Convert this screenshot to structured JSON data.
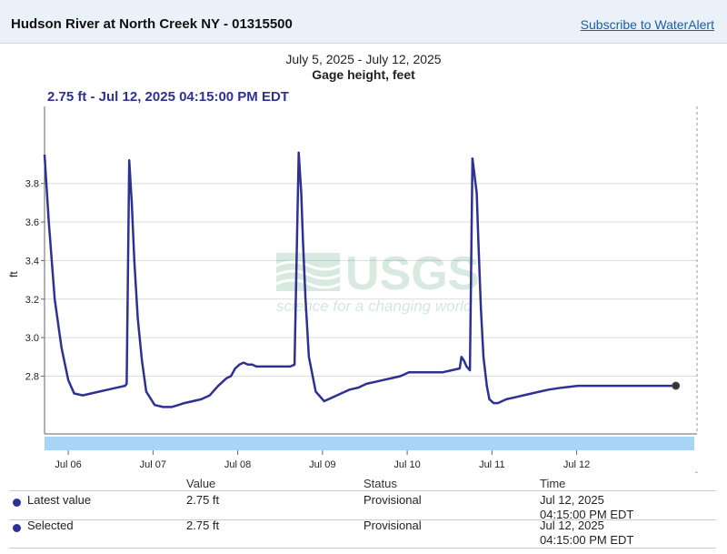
{
  "header": {
    "station_title": "Hudson River at North Creek NY - 01315500",
    "subscribe_label": "Subscribe to WaterAlert"
  },
  "chart_data": {
    "type": "line",
    "date_range": "July 5, 2025 - July 12, 2025",
    "title": "Gage height, feet",
    "selected_readout": "2.75 ft - Jul 12, 2025 04:15:00 PM EDT",
    "ylabel": "ft",
    "xlabel": "",
    "ylim": [
      2.5,
      4.2
    ],
    "xlim": [
      0,
      7.7
    ],
    "y_ticks": [
      2.8,
      3.0,
      3.2,
      3.4,
      3.6,
      3.8
    ],
    "x_tick_labels": [
      "Jul 06",
      "Jul 07",
      "Jul 08",
      "Jul 09",
      "Jul 10",
      "Jul 11",
      "Jul 12"
    ],
    "x_tick_positions": [
      0.28,
      1.28,
      2.28,
      3.28,
      4.28,
      5.28,
      6.28
    ],
    "grid": true,
    "line_color": "#2e3192",
    "series": [
      {
        "x": [
          0.0,
          0.05,
          0.12,
          0.2,
          0.28,
          0.35,
          0.45,
          0.55,
          0.65,
          0.75,
          0.85,
          0.95,
          0.97,
          1.0,
          1.03,
          1.06,
          1.1,
          1.15,
          1.2,
          1.3,
          1.4,
          1.5,
          1.58,
          1.65,
          1.75,
          1.85,
          1.95,
          2.05,
          2.15,
          2.2,
          2.25,
          2.3,
          2.35,
          2.4,
          2.45,
          2.5,
          2.55,
          2.6,
          2.7,
          2.8,
          2.9,
          2.95,
          3.0,
          3.03,
          3.05,
          3.08,
          3.12,
          3.2,
          3.3,
          3.4,
          3.5,
          3.6,
          3.7,
          3.8,
          3.9,
          4.0,
          4.1,
          4.2,
          4.3,
          4.4,
          4.5,
          4.6,
          4.7,
          4.8,
          4.9,
          4.92,
          4.95,
          4.98,
          5.02,
          5.05,
          5.1,
          5.12,
          5.15,
          5.18,
          5.22,
          5.25,
          5.3,
          5.35,
          5.45,
          5.55,
          5.65,
          5.75,
          5.85,
          5.95,
          6.1,
          6.3,
          6.5,
          6.7,
          6.9,
          7.1,
          7.3,
          7.45
        ],
        "values": [
          3.95,
          3.6,
          3.2,
          2.95,
          2.78,
          2.71,
          2.7,
          2.71,
          2.72,
          2.73,
          2.74,
          2.75,
          2.76,
          3.92,
          3.7,
          3.4,
          3.1,
          2.88,
          2.72,
          2.65,
          2.64,
          2.64,
          2.65,
          2.66,
          2.67,
          2.68,
          2.7,
          2.75,
          2.79,
          2.8,
          2.84,
          2.86,
          2.87,
          2.86,
          2.86,
          2.85,
          2.85,
          2.85,
          2.85,
          2.85,
          2.85,
          2.86,
          3.96,
          3.75,
          3.5,
          3.2,
          2.9,
          2.72,
          2.67,
          2.69,
          2.71,
          2.73,
          2.74,
          2.76,
          2.77,
          2.78,
          2.79,
          2.8,
          2.82,
          2.82,
          2.82,
          2.82,
          2.82,
          2.83,
          2.84,
          2.9,
          2.88,
          2.85,
          2.83,
          3.93,
          3.75,
          3.5,
          3.15,
          2.9,
          2.75,
          2.68,
          2.66,
          2.66,
          2.68,
          2.69,
          2.7,
          2.71,
          2.72,
          2.73,
          2.74,
          2.75,
          2.75,
          2.75,
          2.75,
          2.75,
          2.75,
          2.75
        ]
      }
    ],
    "selected_point": {
      "x": 7.45,
      "value": 2.75
    }
  },
  "table": {
    "headers": {
      "value": "Value",
      "status": "Status",
      "time": "Time"
    },
    "rows": [
      {
        "label": "Latest value",
        "value": "2.75 ft",
        "status": "Provisional",
        "time_date": "Jul 12, 2025",
        "time_clock": "04:15:00 PM EDT"
      },
      {
        "label": "Selected",
        "value": "2.75 ft",
        "status": "Provisional",
        "time_date": "Jul 12, 2025",
        "time_clock": "04:15:00 PM EDT"
      }
    ]
  },
  "watermark": {
    "logo_text": "USGS",
    "tagline": "science for a changing world"
  }
}
